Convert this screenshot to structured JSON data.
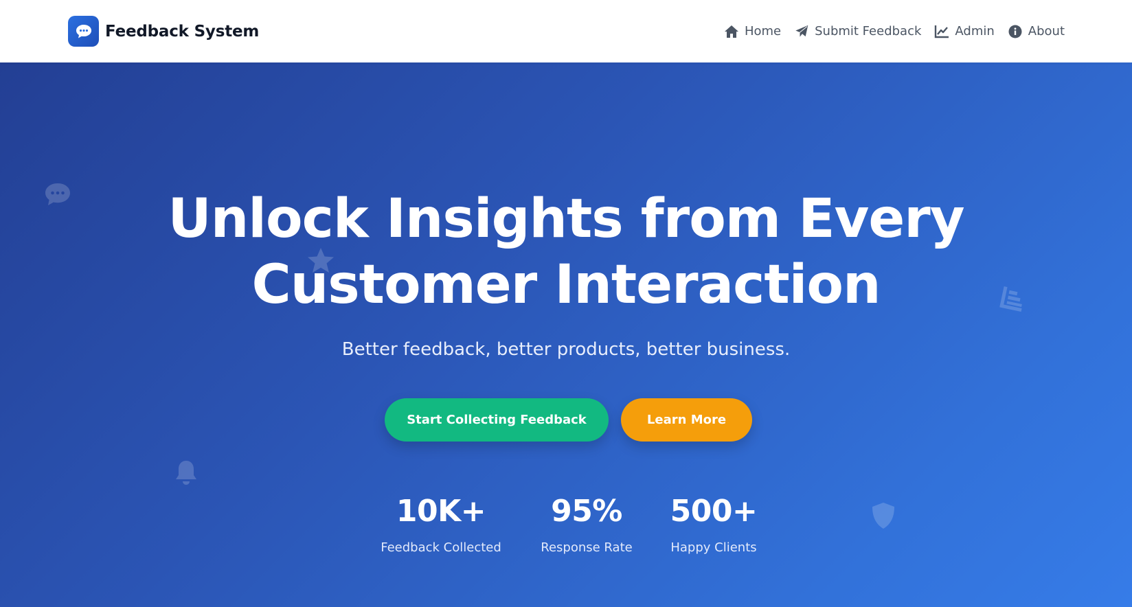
{
  "brand": {
    "name": "Feedback System",
    "logo_icon": "chat-bubble-icon"
  },
  "nav": {
    "items": [
      {
        "label": "Home",
        "icon": "home-icon"
      },
      {
        "label": "Submit Feedback",
        "icon": "paper-plane-icon"
      },
      {
        "label": "Admin",
        "icon": "chart-line-icon"
      },
      {
        "label": "About",
        "icon": "info-circle-icon"
      }
    ]
  },
  "hero": {
    "title_line1": "Unlock Insights from Every",
    "title_line2": "Customer Interaction",
    "subtitle": "Better feedback, better products, better business.",
    "primary_button": "Start Collecting Feedback",
    "secondary_button": "Learn More",
    "stats": [
      {
        "value": "10K+",
        "label": "Feedback Collected"
      },
      {
        "value": "95%",
        "label": "Response Rate"
      },
      {
        "value": "500+",
        "label": "Happy Clients"
      }
    ],
    "background_icons": [
      "comment-dots-icon",
      "star-icon",
      "bell-icon",
      "list-icon",
      "shield-icon"
    ]
  },
  "colors": {
    "hero_gradient_start": "#233f94",
    "hero_gradient_end": "#367ce8",
    "primary_button": "#12b981",
    "secondary_button": "#f59e0b",
    "brand_logo": "#2b6fe0"
  }
}
